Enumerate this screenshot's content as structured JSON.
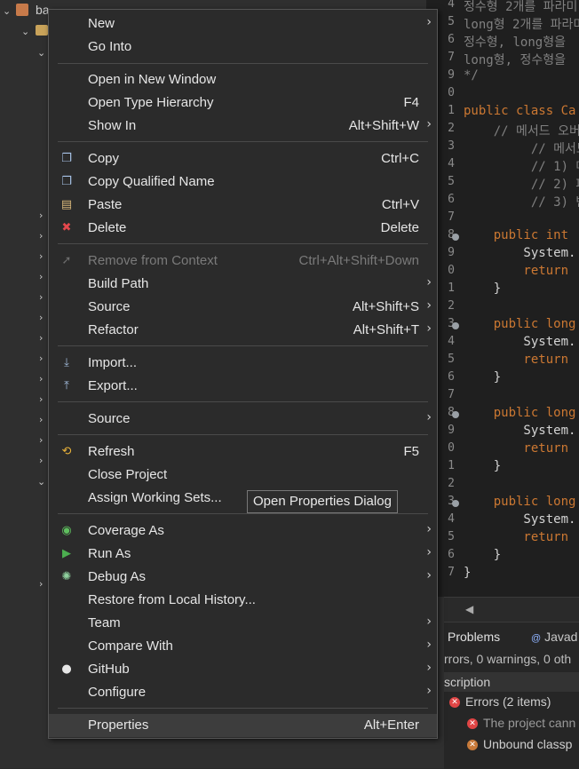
{
  "tree": {
    "root_label": "ba"
  },
  "editor": {
    "line_numbers": [
      "4",
      "5",
      "6",
      "7",
      "9",
      "0",
      "1",
      "2",
      "3",
      "4",
      "5",
      "6",
      "7",
      "8",
      "9",
      "0",
      "1",
      "2",
      "3",
      "4",
      "5",
      "6",
      "7",
      "8",
      "9",
      "0",
      "1",
      "2",
      "3",
      "4",
      "5",
      "6",
      "7"
    ],
    "lines": [
      {
        "text": "정수형 2개를 파라미",
        "cls": "cm"
      },
      {
        "text": "long형 2개를 파라미",
        "cls": "cm"
      },
      {
        "text": "정수형, long형을",
        "cls": "cm"
      },
      {
        "text": "long형, 정수형을",
        "cls": "cm"
      },
      {
        "text": "*/",
        "cls": "cm"
      },
      {
        "text": "",
        "cls": ""
      },
      {
        "text": "public class Ca",
        "cls": "kw"
      },
      {
        "text": "    // 메서드 오버",
        "cls": "cm"
      },
      {
        "text": "         // 메서드",
        "cls": "cm"
      },
      {
        "text": "         // 1) 매",
        "cls": "cm"
      },
      {
        "text": "         // 2) 파",
        "cls": "cm"
      },
      {
        "text": "         // 3) 반",
        "cls": "cm"
      },
      {
        "text": "",
        "cls": ""
      },
      {
        "text": "    public int",
        "cls": "kw"
      },
      {
        "text": "        System.",
        "cls": ""
      },
      {
        "text": "        return",
        "cls": "kw"
      },
      {
        "text": "    }",
        "cls": ""
      },
      {
        "text": "",
        "cls": ""
      },
      {
        "text": "    public long",
        "cls": "kw"
      },
      {
        "text": "        System.",
        "cls": ""
      },
      {
        "text": "        return",
        "cls": "kw"
      },
      {
        "text": "    }",
        "cls": ""
      },
      {
        "text": "",
        "cls": ""
      },
      {
        "text": "    public long",
        "cls": "kw"
      },
      {
        "text": "        System.",
        "cls": ""
      },
      {
        "text": "        return",
        "cls": "kw"
      },
      {
        "text": "    }",
        "cls": ""
      },
      {
        "text": "",
        "cls": ""
      },
      {
        "text": "    public long",
        "cls": "kw"
      },
      {
        "text": "        System.",
        "cls": ""
      },
      {
        "text": "        return",
        "cls": "kw"
      },
      {
        "text": "    }",
        "cls": ""
      },
      {
        "text": "}",
        "cls": ""
      }
    ]
  },
  "problems": {
    "tab_active": "Problems",
    "tab_other": "Javad",
    "summary": "rrors, 0 warnings, 0 oth",
    "column": "scription",
    "group": "Errors (2 items)",
    "row1": "The project cann",
    "row2": "Unbound classp"
  },
  "menu": {
    "new": "New",
    "go_into": "Go Into",
    "open_new_window": "Open in New Window",
    "open_type_hierarchy": "Open Type Hierarchy",
    "open_type_hierarchy_acc": "F4",
    "show_in": "Show In",
    "show_in_acc": "Alt+Shift+W",
    "copy": "Copy",
    "copy_acc": "Ctrl+C",
    "copy_qualified": "Copy Qualified Name",
    "paste": "Paste",
    "paste_acc": "Ctrl+V",
    "delete": "Delete",
    "delete_acc": "Delete",
    "remove_context": "Remove from Context",
    "remove_context_acc": "Ctrl+Alt+Shift+Down",
    "build_path": "Build Path",
    "source1": "Source",
    "source1_acc": "Alt+Shift+S",
    "refactor": "Refactor",
    "refactor_acc": "Alt+Shift+T",
    "import": "Import...",
    "export": "Export...",
    "source2": "Source",
    "refresh": "Refresh",
    "refresh_acc": "F5",
    "close_project": "Close Project",
    "assign_working_sets": "Assign Working Sets...",
    "coverage_as": "Coverage As",
    "run_as": "Run As",
    "debug_as": "Debug As",
    "restore_history": "Restore from Local History...",
    "team": "Team",
    "compare_with": "Compare With",
    "github": "GitHub",
    "configure": "Configure",
    "properties": "Properties",
    "properties_acc": "Alt+Enter"
  },
  "tooltip": "Open Properties Dialog",
  "colors": {
    "menu_bg": "#2b2b2b",
    "highlight": "#3d3d3d",
    "keyword": "#cc7832",
    "error": "#e04545"
  }
}
